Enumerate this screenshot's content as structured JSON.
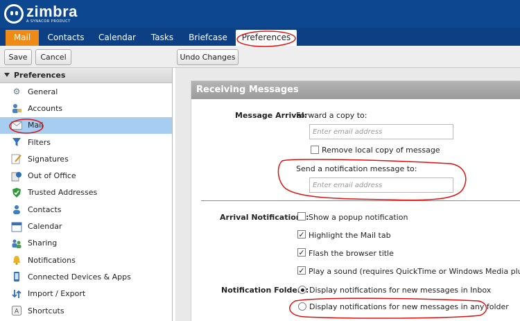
{
  "app": {
    "logo_text": "zimbra",
    "logo_subtext": "A SYNACOR PRODUCT"
  },
  "tabs": [
    {
      "label": "Mail"
    },
    {
      "label": "Contacts"
    },
    {
      "label": "Calendar"
    },
    {
      "label": "Tasks"
    },
    {
      "label": "Briefcase"
    },
    {
      "label": "Preferences"
    }
  ],
  "toolbar": {
    "save_label": "Save",
    "cancel_label": "Cancel",
    "undo_label": "Undo Changes"
  },
  "sidebar": {
    "title": "Preferences",
    "items": [
      {
        "label": "General",
        "icon": "gear-icon"
      },
      {
        "label": "Accounts",
        "icon": "accounts-icon"
      },
      {
        "label": "Mail",
        "icon": "mail-icon"
      },
      {
        "label": "Filters",
        "icon": "filter-icon"
      },
      {
        "label": "Signatures",
        "icon": "signature-icon"
      },
      {
        "label": "Out of Office",
        "icon": "out-of-office-icon"
      },
      {
        "label": "Trusted Addresses",
        "icon": "shield-icon"
      },
      {
        "label": "Contacts",
        "icon": "contacts-icon"
      },
      {
        "label": "Calendar",
        "icon": "calendar-icon"
      },
      {
        "label": "Sharing",
        "icon": "sharing-icon"
      },
      {
        "label": "Notifications",
        "icon": "bell-icon"
      },
      {
        "label": "Connected Devices & Apps",
        "icon": "devices-icon"
      },
      {
        "label": "Import / Export",
        "icon": "import-export-icon"
      },
      {
        "label": "Shortcuts",
        "icon": "shortcuts-icon"
      }
    ],
    "selected": "Mail"
  },
  "receiving": {
    "title": "Receiving Messages",
    "message_arrival_label": "Message Arrival:",
    "forward_label": "Forward a copy to:",
    "forward_placeholder": "Enter email address",
    "forward_value": "",
    "remove_copy_label": "Remove local copy of message",
    "remove_copy_checked": false,
    "notify_label": "Send a notification message to:",
    "notify_placeholder": "Enter email address",
    "notify_value": "",
    "arrival_notifications_label": "Arrival Notifications:",
    "arrival_options": [
      {
        "label": "Show a popup notification",
        "checked": false
      },
      {
        "label": "Highlight the Mail tab",
        "checked": true
      },
      {
        "label": "Flash the browser title",
        "checked": true
      },
      {
        "label": "Play a sound (requires QuickTime or Windows Media plugin)",
        "checked": true
      }
    ],
    "notification_folders_label": "Notification Folders:",
    "folder_options": [
      {
        "label": "Display notifications for new messages in Inbox",
        "selected": true
      },
      {
        "label": "Display notifications for new messages in any folder",
        "selected": false
      }
    ]
  },
  "colors": {
    "header_bg": "#0c4790",
    "active_tab": "#f08a16",
    "selection": "#a7cdf1",
    "annotation": "#e01010"
  }
}
